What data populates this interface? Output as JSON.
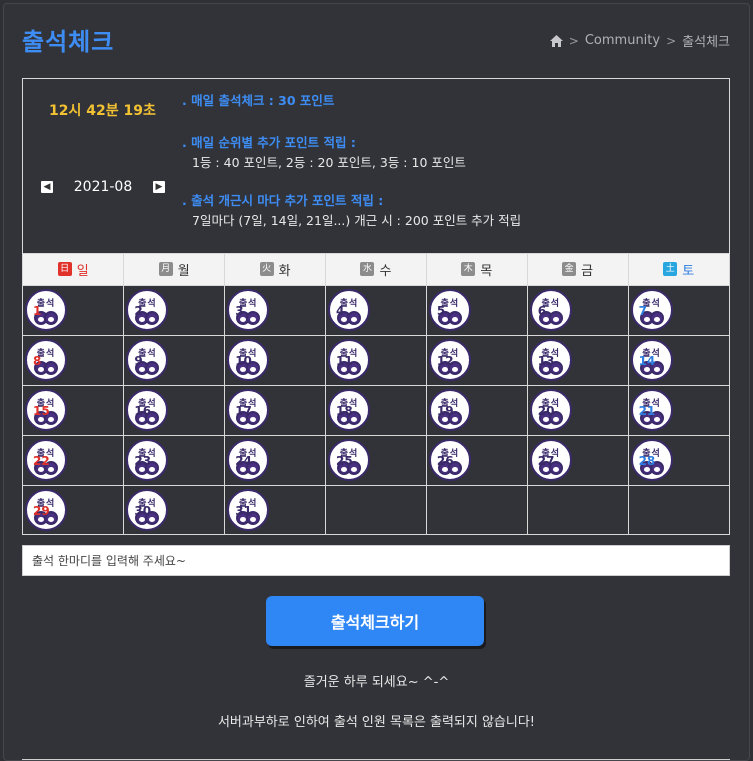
{
  "header": {
    "title": "출석체크",
    "breadcrumb": {
      "home_icon": "home-icon",
      "section": "Community",
      "current": "출석체크"
    }
  },
  "info": {
    "clock": "12시 42분 19초",
    "month": "2021-08",
    "prev_icon": "chevron-left-icon",
    "next_icon": "chevron-right-icon",
    "rules": [
      {
        "title": ". 매일 출석체크 : 30 포인트",
        "body": ""
      },
      {
        "title": ". 매일 순위별 추가 포인트 적립 :",
        "body": "1등 : 40 포인트,  2등 : 20 포인트,  3등 : 10 포인트"
      },
      {
        "title": ". 출석 개근시 마다 추가 포인트 적립 :",
        "body": "7일마다 (7일, 14일, 21일...) 개근 시 : 200 포인트 추가 적립"
      }
    ]
  },
  "calendar": {
    "weekdays": [
      {
        "badge": "日",
        "name": "일",
        "type": "sun"
      },
      {
        "badge": "月",
        "name": "월",
        "type": "wk"
      },
      {
        "badge": "火",
        "name": "화",
        "type": "wk"
      },
      {
        "badge": "水",
        "name": "수",
        "type": "wk"
      },
      {
        "badge": "木",
        "name": "목",
        "type": "wk"
      },
      {
        "badge": "金",
        "name": "금",
        "type": "wk"
      },
      {
        "badge": "土",
        "name": "토",
        "type": "sat"
      }
    ],
    "stamp_text": "출석",
    "weeks": [
      [
        "1",
        "2",
        "3",
        "4",
        "5",
        "6",
        "7"
      ],
      [
        "8",
        "9",
        "10",
        "11",
        "12",
        "13",
        "14"
      ],
      [
        "15",
        "16",
        "17",
        "18",
        "19",
        "20",
        "21"
      ],
      [
        "22",
        "23",
        "24",
        "25",
        "26",
        "27",
        "28"
      ],
      [
        "29",
        "30",
        "31",
        "",
        "",
        "",
        ""
      ]
    ]
  },
  "comment": {
    "placeholder": "출석 한마디를 입력해 주세요~"
  },
  "action": {
    "button_label": "출석체크하기"
  },
  "messages": {
    "greeting": "즐거운 하루 되세요~ ^-^",
    "notice": "서버과부하로 인하여 출석 인원 목록은 출력되지 않습니다!"
  },
  "colors": {
    "accent": "#3d8df5",
    "clock": "#f2c233",
    "sunday": "#e0312b",
    "saturday": "#2f7ee0",
    "background": "#2f3035"
  }
}
